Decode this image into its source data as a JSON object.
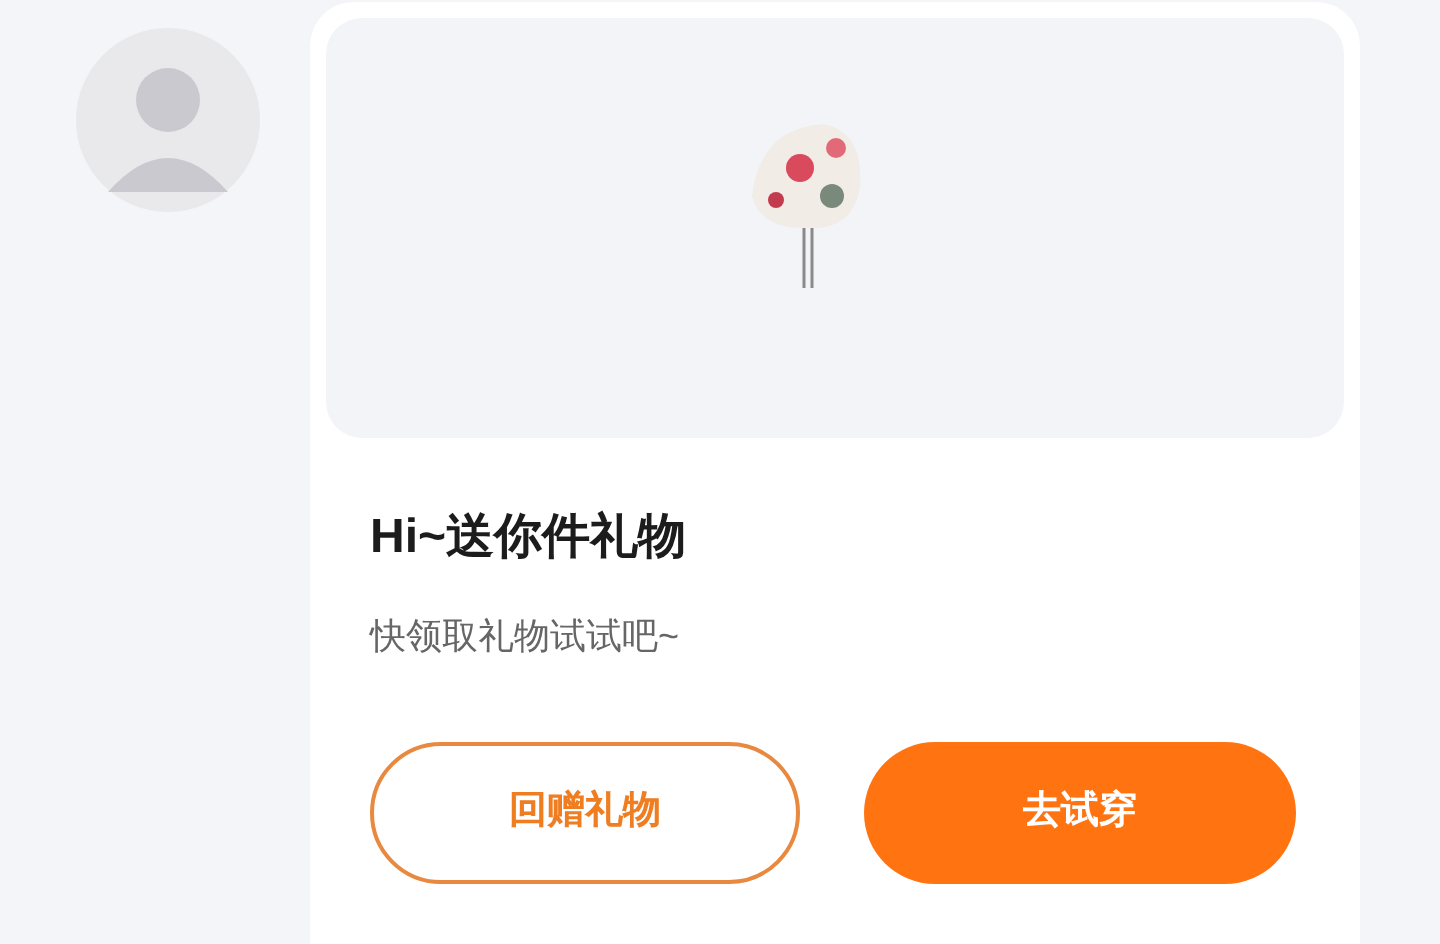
{
  "gift_card": {
    "title": "Hi~送你件礼物",
    "subtitle": "快领取礼物试试吧~",
    "buttons": [
      {
        "label": "回赠礼物",
        "kind": "outline"
      },
      {
        "label": "去试穿",
        "kind": "filled"
      }
    ]
  }
}
